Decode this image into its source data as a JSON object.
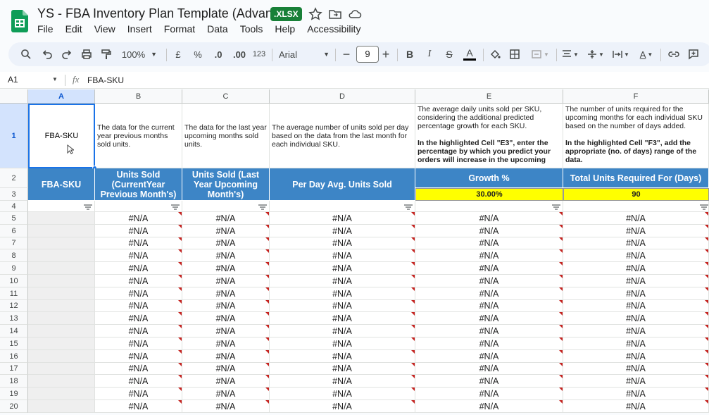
{
  "app": {
    "title": "YS - FBA Inventory Plan Template (Advanced)",
    "badge": ".XLSX",
    "menu": [
      "File",
      "Edit",
      "View",
      "Insert",
      "Format",
      "Data",
      "Tools",
      "Help",
      "Accessibility"
    ]
  },
  "toolbar": {
    "zoom": "100%",
    "currency": "£",
    "percent": "%",
    "dec_decrease": ".0",
    "dec_increase": ".00",
    "number_format": "123",
    "font": "Arial",
    "font_size": "9",
    "minus": "−",
    "plus": "+",
    "bold": "B",
    "italic": "I",
    "strike": "S",
    "text_color": "A"
  },
  "formula_bar": {
    "name_box": "A1",
    "fx": "fx",
    "value": "FBA-SKU"
  },
  "columns": [
    "A",
    "B",
    "C",
    "D",
    "E",
    "F"
  ],
  "rows": [
    "1",
    "2",
    "3",
    "4",
    "5",
    "6",
    "7",
    "8",
    "9",
    "10",
    "11",
    "12",
    "13",
    "14",
    "15",
    "16",
    "17",
    "18",
    "19",
    "20"
  ],
  "row1": {
    "a": "FBA-SKU",
    "b": "The data for the current year previous months sold units.",
    "c": "The data for the last year upcoming months sold units.",
    "d": "The average number of units sold per day based on the data from the last month for each individual SKU.",
    "e1": "The average daily units sold per SKU, considering the additional predicted percentage growth for each SKU.",
    "e2": "In the highlighted Cell \"E3\", enter the percentage by which you predict your orders will increase in the upcoming",
    "f1": "The number of units required for the upcoming months for each individual SKU based on the number of days added.",
    "f2": "In the highlighted Cell \"F3\", add the appropriate (no. of days) range of the data."
  },
  "headers": {
    "a": "FBA-SKU",
    "b": "Units Sold (CurrentYear Previous Month's)",
    "c": "Units Sold (Last Year Upcoming Month's)",
    "d": "Per Day Avg. Units Sold",
    "e": "Growth %",
    "f": "Total Units Required For (Days)"
  },
  "inputs": {
    "e3": "30.00%",
    "f3": "90"
  },
  "error_value": "#N/A",
  "colors": {
    "header_blue": "#3d85c6",
    "input_yellow": "#ffff00",
    "badge_green": "#188038"
  }
}
